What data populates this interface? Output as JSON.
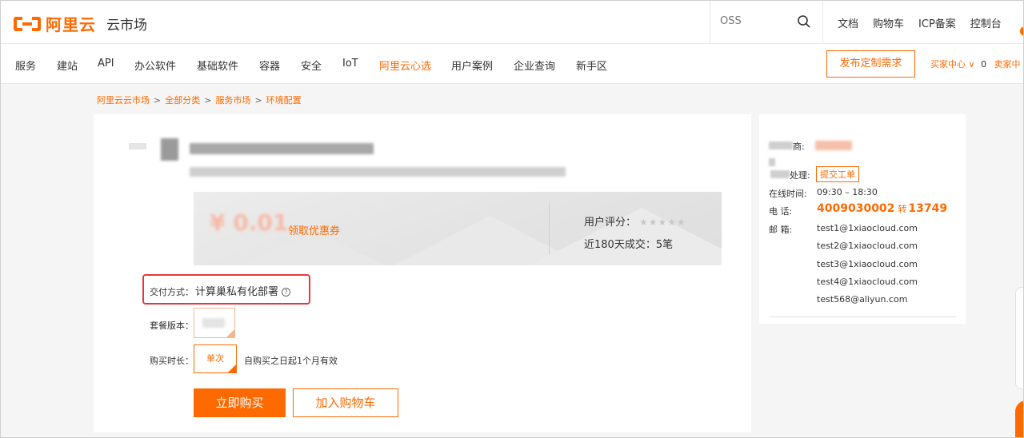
{
  "header": {
    "brand": "阿里云",
    "sub_brand": "云市场",
    "search_placeholder": "OSS",
    "top_links": [
      "文档",
      "购物车",
      "ICP备案",
      "控制台"
    ]
  },
  "nav": {
    "items": [
      "服务",
      "建站",
      "API",
      "办公软件",
      "基础软件",
      "容器",
      "安全",
      "IoT",
      "阿里云心选",
      "用户案例",
      "企业查询",
      "新手区"
    ],
    "active_index": 8,
    "publish_button": "发布定制需求",
    "buyer_center": "买家中心",
    "cart_count": "0",
    "seller_center": "卖家中"
  },
  "breadcrumb": {
    "items": [
      "阿里云云市场",
      "全部分类",
      "服务市场",
      "环境配置"
    ],
    "separator": ">"
  },
  "product": {
    "price": "0.01",
    "coupon_link": "领取优惠券",
    "rating_label": "用户评分：",
    "rating_stars": "★★★★★",
    "sales_text": "近180天成交：5笔",
    "delivery_label": "交付方式：",
    "delivery_value": "计算巢私有化部署",
    "help_glyph": "?",
    "package_label": "套餐版本：",
    "duration_label": "购买时长：",
    "duration_option": "单次",
    "duration_note": "自购买之日起1个月有效",
    "buy_button": "立即购买",
    "cart_button": "加入购物车"
  },
  "seller": {
    "vendor_suffix": "商:",
    "handle_suffix": "处理:",
    "ticket_button": "提交工单",
    "online_label": "在线时间:",
    "online_value": "09:30 – 18:30",
    "phone_label": "电 话:",
    "phone_main": "4009030002",
    "phone_ext_label": "转",
    "phone_ext": "13749",
    "email_label": "邮 箱:",
    "emails": [
      "test1@1xiaocloud.com",
      "test2@1xiaocloud.com",
      "test3@1xiaocloud.com",
      "test4@1xiaocloud.com",
      "test568@aliyun.com"
    ]
  },
  "colors": {
    "accent": "#ff6a00",
    "highlight_box": "#e5383b"
  }
}
